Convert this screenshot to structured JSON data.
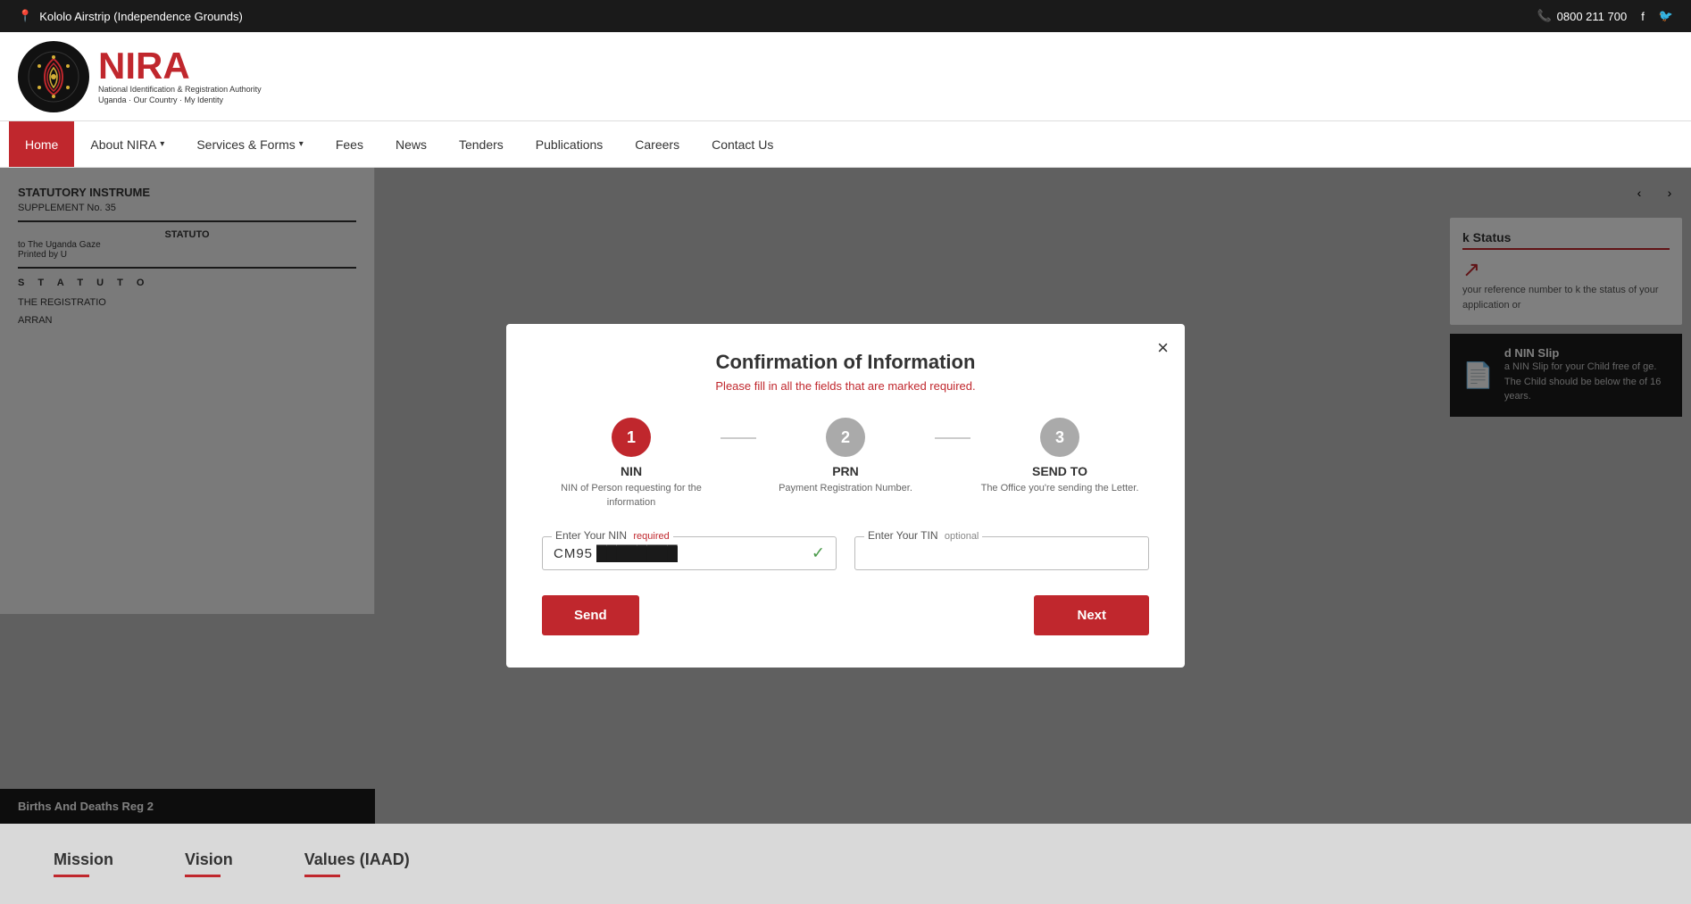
{
  "topbar": {
    "location": "Kololo Airstrip (Independence Grounds)",
    "phone": "0800 211 700"
  },
  "nav": {
    "items": [
      {
        "id": "home",
        "label": "Home",
        "active": true,
        "hasArrow": false
      },
      {
        "id": "about",
        "label": "About NIRA",
        "active": false,
        "hasArrow": true
      },
      {
        "id": "services",
        "label": "Services & Forms",
        "active": false,
        "hasArrow": true
      },
      {
        "id": "fees",
        "label": "Fees",
        "active": false,
        "hasArrow": false
      },
      {
        "id": "news",
        "label": "News",
        "active": false,
        "hasArrow": false
      },
      {
        "id": "tenders",
        "label": "Tenders",
        "active": false,
        "hasArrow": false
      },
      {
        "id": "publications",
        "label": "Publications",
        "active": false,
        "hasArrow": false
      },
      {
        "id": "careers",
        "label": "Careers",
        "active": false,
        "hasArrow": false
      },
      {
        "id": "contact",
        "label": "Contact Us",
        "active": false,
        "hasArrow": false
      }
    ]
  },
  "bgdoc": {
    "line1": "STATUTORY INSTRUME",
    "line2": "SUPPLEMENT No. 35",
    "line3": "STATUTO",
    "line4": "to The Uganda Gaze",
    "line5": "Printed by U",
    "line6": "S T A T U T O",
    "line7": "THE REGISTRATIO",
    "line8": "ARRAN",
    "footer": "Births And Deaths Reg 2"
  },
  "rightcards": {
    "card1": {
      "title": "k Status",
      "text": "your reference number to k the status of your application or"
    },
    "card2": {
      "title": "d NIN Slip",
      "text": "a NIN Slip for your Child free of ge. The Child should be below the of 16 years."
    }
  },
  "modal": {
    "title": "Confirmation of Information",
    "subtitle": "Please fill in all the fields that are marked required.",
    "close_label": "×",
    "steps": [
      {
        "number": "1",
        "label": "NIN",
        "desc": "NIN of Person requesting for the information",
        "active": true
      },
      {
        "number": "2",
        "label": "PRN",
        "desc": "Payment Registration Number.",
        "active": false
      },
      {
        "number": "3",
        "label": "SEND TO",
        "desc": "The Office you're sending the Letter.",
        "active": false
      }
    ],
    "nin_field": {
      "label": "Enter Your NIN",
      "required_text": "required",
      "value_prefix": "CM95",
      "value_masked": "●●●●●●●●"
    },
    "tin_field": {
      "label": "Enter Your TIN",
      "optional_text": "optional",
      "placeholder": ""
    },
    "send_button": "Send",
    "next_button": "Next"
  },
  "footer": {
    "mission_label": "Mission",
    "vision_label": "Vision",
    "values_label": "Values (IAAD)"
  }
}
